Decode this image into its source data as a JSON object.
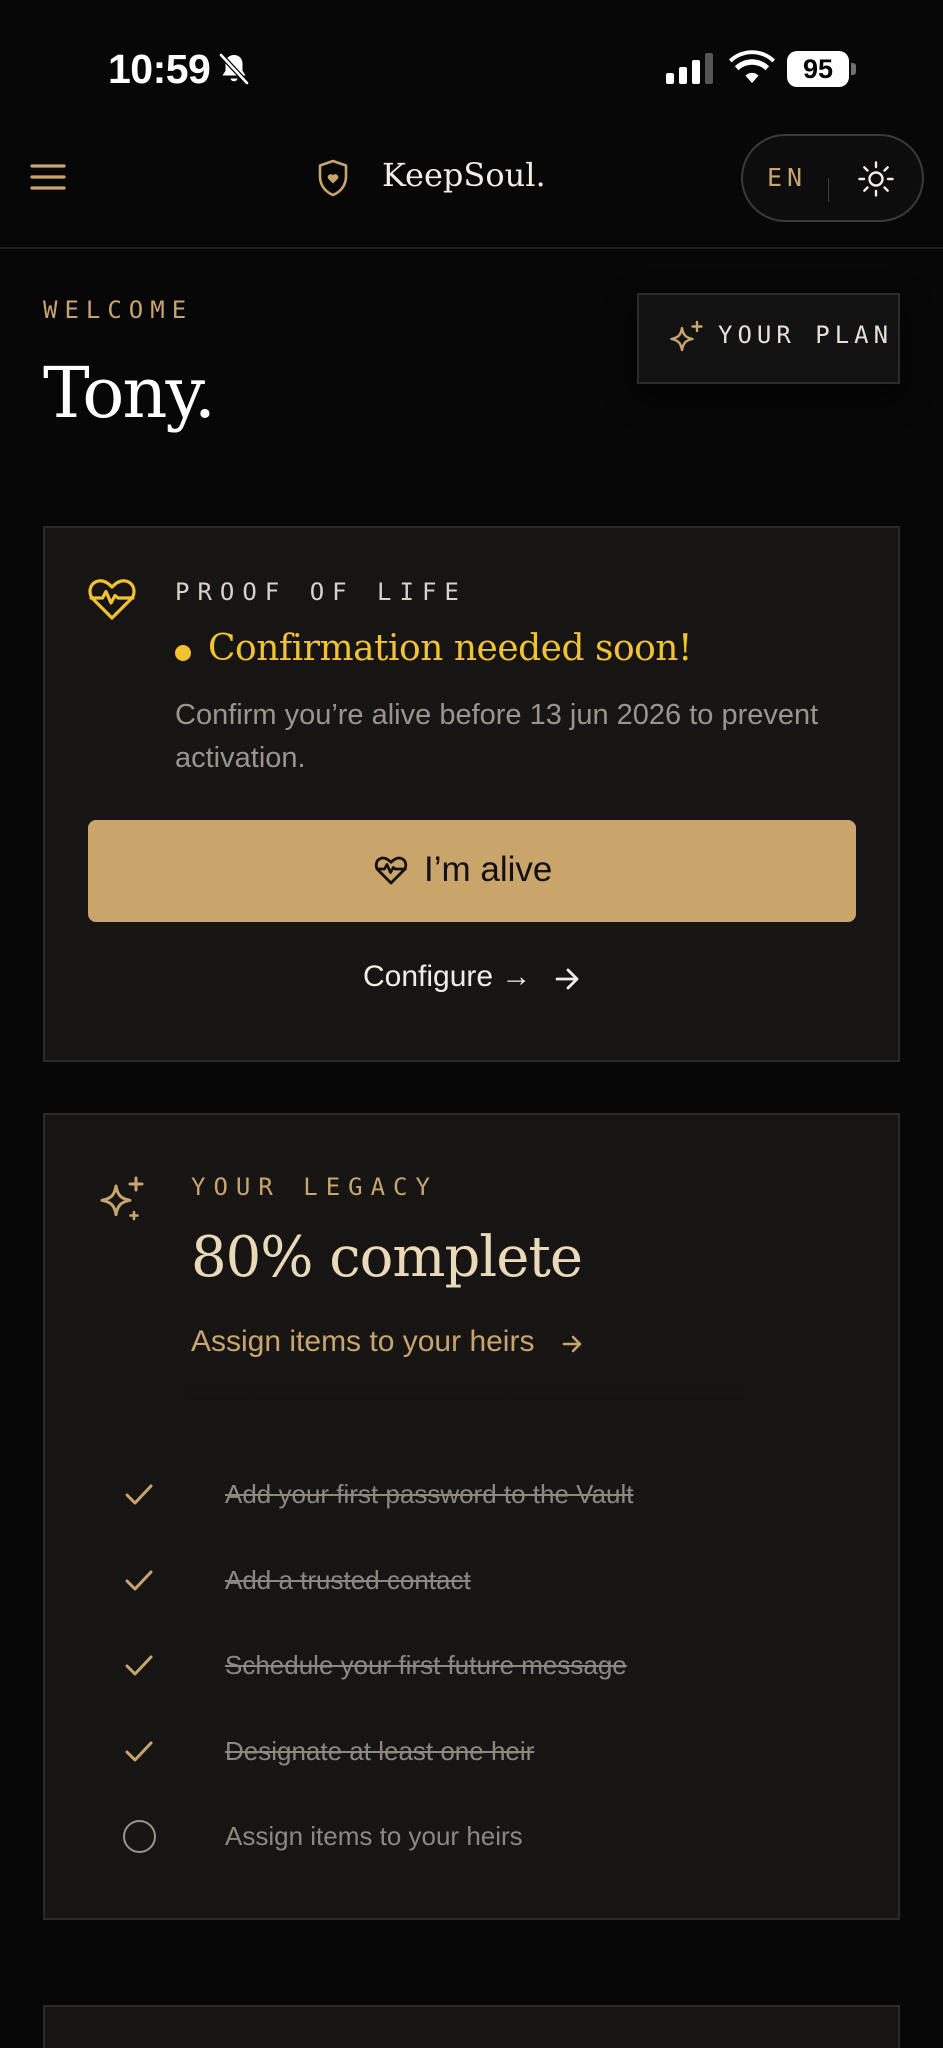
{
  "status_bar": {
    "time": "10:59",
    "battery": "95"
  },
  "header": {
    "brand": "KeepSoul.",
    "language": "EN"
  },
  "welcome": {
    "label": "WELCOME",
    "name": "Tony.",
    "plan_button": "YOUR PLAN"
  },
  "proof_of_life": {
    "label": "PROOF OF LIFE",
    "status_title": "Confirmation needed soon!",
    "description": "Confirm you’re alive before 13 jun 2026 to prevent activation.",
    "button": "I’m alive",
    "configure": "Configure →"
  },
  "legacy": {
    "label": "YOUR LEGACY",
    "progress_percent": 80,
    "title": "80% complete",
    "link": "Assign items to your heirs",
    "tasks": [
      {
        "label": "Add your first password to the Vault",
        "done": true
      },
      {
        "label": "Add a trusted contact",
        "done": true
      },
      {
        "label": "Schedule your first future message",
        "done": true
      },
      {
        "label": "Designate at least one heir",
        "done": true
      },
      {
        "label": "Assign items to your heirs",
        "done": false
      }
    ]
  },
  "colors": {
    "background": "#070707",
    "accent_gold": "#c9a46b",
    "warning_yellow": "#f2c230",
    "card": "#161514"
  },
  "icons": [
    "bell-slash-icon",
    "signal-icon",
    "wifi-icon",
    "battery-icon",
    "hamburger-menu-icon",
    "shield-heart-icon",
    "sun-icon",
    "sparkle-icon",
    "heart-pulse-icon",
    "arrow-right-icon",
    "check-icon",
    "circle-icon"
  ]
}
